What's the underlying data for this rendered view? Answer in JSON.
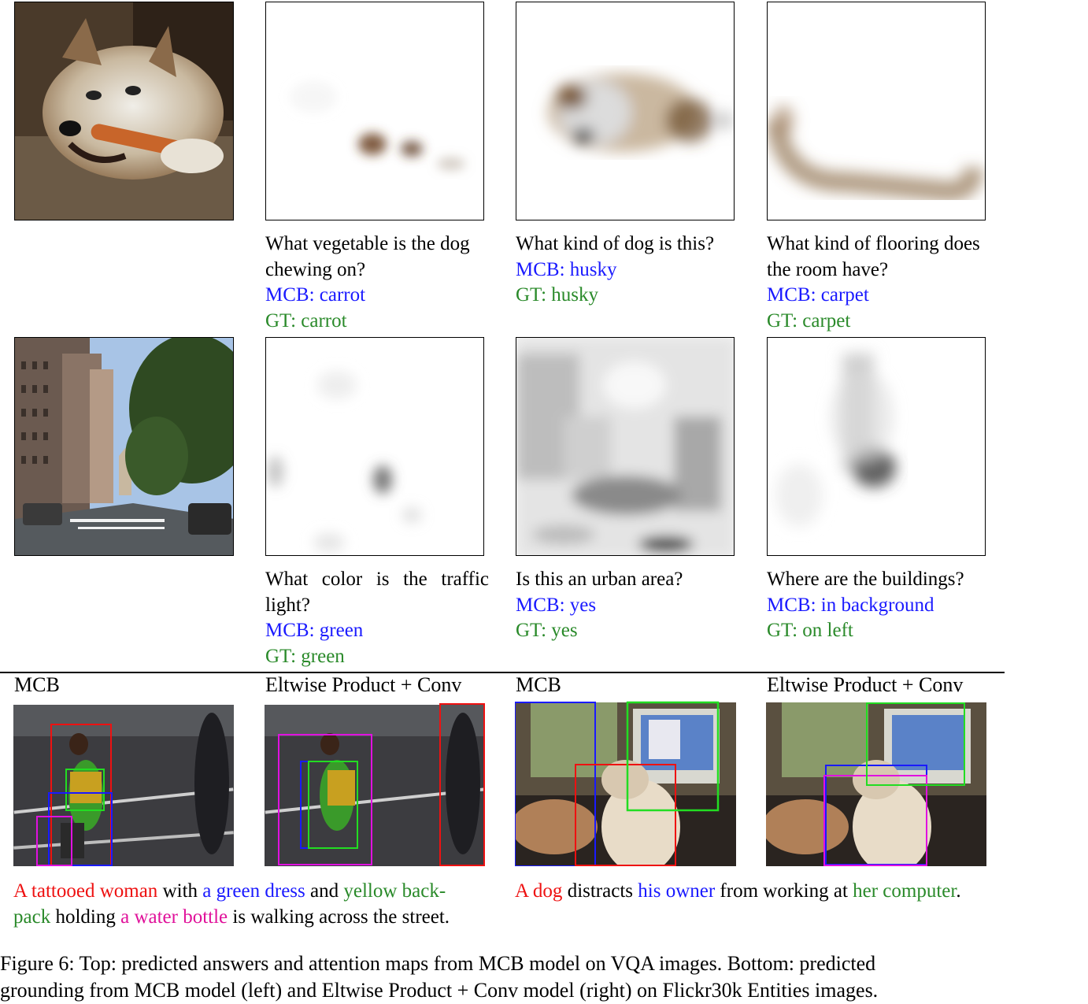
{
  "top_rows": [
    {
      "panels": [
        {
          "question": [
            "What vegetable is the dog",
            "chewing on?"
          ],
          "mcb": "MCB: carrot",
          "gt": "GT: carrot"
        },
        {
          "question": [
            "What kind of dog is this?"
          ],
          "mcb": "MCB: husky",
          "gt": "GT: husky"
        },
        {
          "question": [
            "What kind of flooring does",
            "the room have?"
          ],
          "mcb": "MCB: carpet",
          "gt": "GT: carpet"
        }
      ]
    },
    {
      "panels": [
        {
          "question": [
            "What  color  is  the  traffic",
            "light?"
          ],
          "mcb": "MCB: green",
          "gt": "GT: green"
        },
        {
          "question": [
            "Is this an urban area?"
          ],
          "mcb": "MCB: yes",
          "gt": "GT: yes"
        },
        {
          "question": [
            "Where are the buildings?"
          ],
          "mcb": "MCB: in background",
          "gt": "GT: on left"
        }
      ]
    }
  ],
  "bottom": {
    "headers": [
      "MCB",
      "Eltwise Product + Conv",
      "MCB",
      "Eltwise Product + Conv"
    ],
    "left_sentence": {
      "line1": [
        {
          "text": "A tattooed woman",
          "color": "#ee1111"
        },
        {
          "text": " with ",
          "color": "#000000"
        },
        {
          "text": "a green dress",
          "color": "#1a1aff"
        },
        {
          "text": " and ",
          "color": "#000000"
        },
        {
          "text": "yellow back-",
          "color": "#2a8a2a"
        }
      ],
      "line2": [
        {
          "text": "pack",
          "color": "#2a8a2a"
        },
        {
          "text": " holding ",
          "color": "#000000"
        },
        {
          "text": "a water bottle",
          "color": "#e0119a"
        },
        {
          "text": " is walking across the street.",
          "color": "#000000"
        }
      ]
    },
    "right_sentence": {
      "line1": [
        {
          "text": "A dog",
          "color": "#ee1111"
        },
        {
          "text": " distracts ",
          "color": "#000000"
        },
        {
          "text": "his owner",
          "color": "#1a1aff"
        },
        {
          "text": " from working at ",
          "color": "#000000"
        },
        {
          "text": "her computer",
          "color": "#2a8a2a"
        },
        {
          "text": ".",
          "color": "#000000"
        }
      ]
    }
  },
  "caption": {
    "line1": "Figure 6: Top: predicted answers and attention maps from MCB model on VQA images. Bottom: predicted",
    "line2": "grounding from MCB model (left) and Eltwise Product + Conv model (right) on Flickr30k Entities images."
  },
  "colors": {
    "blue": "#1a1aff",
    "green": "#2a8a2a",
    "red": "#ee1111",
    "magenta": "#e0119a",
    "lime": "#22dd22"
  }
}
